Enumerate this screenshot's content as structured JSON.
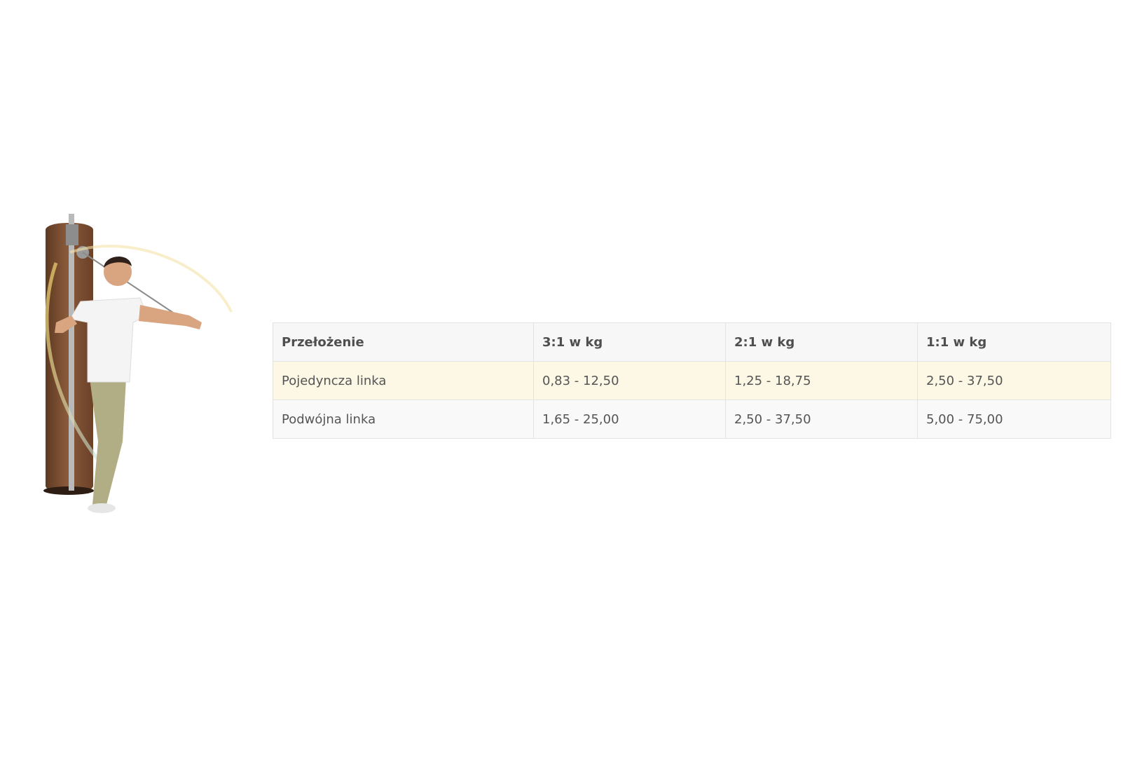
{
  "table": {
    "headers": [
      "Przełożenie",
      "3:1 w kg",
      "2:1 w kg",
      "1:1 w kg"
    ],
    "rows": [
      [
        "Pojedyncza linka",
        "0,83 - 12,50",
        "1,25 - 18,75",
        "2,50 - 37,50"
      ],
      [
        "Podwójna linka",
        "1,65 - 25,00",
        "2,50 - 37,50",
        "5,00 - 75,00"
      ]
    ]
  },
  "colors": {
    "highlight_row": "#fcf8e5",
    "header_bg": "#f7f7f7",
    "border": "#e3e3e3",
    "text": "#555555"
  }
}
